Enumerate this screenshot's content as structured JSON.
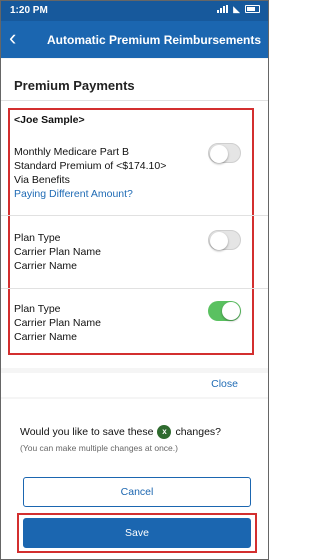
{
  "status_bar": {
    "time": "1:20 PM"
  },
  "header": {
    "title": "Automatic Premium Reimbursements"
  },
  "section": {
    "title": "Premium Payments"
  },
  "person": {
    "name": "<Joe Sample>"
  },
  "items": [
    {
      "line1": "Monthly Medicare Part B",
      "line2": "Standard Premium of <$174.10>",
      "line3": "Via Benefits",
      "link": "Paying Different Amount?",
      "enabled": false
    },
    {
      "line1": "Plan Type",
      "line2": "Carrier Plan Name",
      "line3": "Carrier Name",
      "enabled": false
    },
    {
      "line1": "Plan Type",
      "line2": "Carrier Plan Name",
      "line3": "Carrier Name",
      "enabled": true
    }
  ],
  "close_label": "Close",
  "confirm": {
    "question_prefix": "Would you like to save these",
    "badge": "x",
    "question_suffix": "changes?",
    "hint": "(You can make multiple changes at once.)"
  },
  "buttons": {
    "cancel": "Cancel",
    "save": "Save"
  },
  "colors": {
    "primary": "#1b66b0",
    "highlight": "#d32f2f",
    "toggle_on": "#5ac160",
    "link": "#1f6bb5"
  }
}
